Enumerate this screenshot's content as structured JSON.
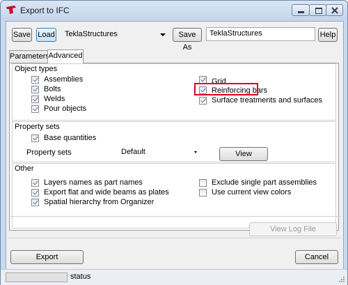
{
  "window": {
    "title": "Export to IFC",
    "accent_color": "#c9daee",
    "controls": {
      "minimize": "minimize-icon",
      "maximize": "maximize-icon",
      "close": "close-icon"
    }
  },
  "toolbar": {
    "save_label": "Save",
    "load_label": "Load",
    "settings_combo_value": "TeklaStructures",
    "save_as_label": "Save As",
    "save_as_value": "TeklaStructures",
    "help_label": "Help"
  },
  "tabs": [
    {
      "label": "Parameters",
      "active": false
    },
    {
      "label": "Advanced",
      "active": true
    }
  ],
  "object_types": {
    "title": "Object types",
    "left": [
      {
        "label": "Assemblies",
        "checked": true
      },
      {
        "label": "Bolts",
        "checked": true
      },
      {
        "label": "Welds",
        "checked": true
      },
      {
        "label": "Pour objects",
        "checked": true
      }
    ],
    "right": [
      {
        "label": "Grid",
        "checked": true
      },
      {
        "label": "Reinforcing bars",
        "checked": true
      },
      {
        "label": "Surface treatments and surfaces",
        "checked": true
      }
    ],
    "highlight_color": "#e0001b"
  },
  "property_sets": {
    "title": "Property sets",
    "base_quantities": {
      "label": "Base quantities",
      "checked": true
    },
    "property_sets_label": "Property sets",
    "property_sets_value": "Default",
    "view_button": "View"
  },
  "other": {
    "title": "Other",
    "left": [
      {
        "label": "Layers names as part names",
        "checked": true
      },
      {
        "label": "Export flat and wide beams as plates",
        "checked": true
      },
      {
        "label": "Spatial hierarchy from Organizer",
        "checked": true
      }
    ],
    "right": [
      {
        "label": "Exclude single part assemblies",
        "checked": false
      },
      {
        "label": "Use current view colors",
        "checked": false
      }
    ]
  },
  "view_log_button": "View Log File",
  "export_button": "Export",
  "cancel_button": "Cancel",
  "status": {
    "text": "status"
  }
}
